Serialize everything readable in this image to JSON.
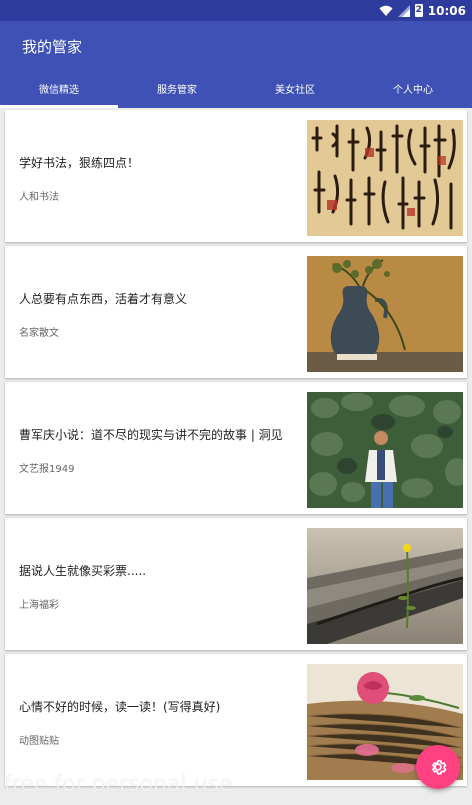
{
  "status_bar": {
    "time": "10:06",
    "icons": [
      "wifi-icon",
      "signal-icon",
      "battery-icon"
    ],
    "battery_text": "2"
  },
  "app_bar": {
    "title": "我的管家",
    "background_color": "#3f51b5"
  },
  "tabs": [
    {
      "label": "微信精选",
      "active": true
    },
    {
      "label": "服务管家",
      "active": false
    },
    {
      "label": "美女社区",
      "active": false
    },
    {
      "label": "个人中心",
      "active": false
    }
  ],
  "articles": [
    {
      "title": "学好书法，狠练四点！",
      "source": "人和书法",
      "image": "calligraphy-image"
    },
    {
      "title": "人总要有点东西，活着才有意义",
      "source": "名家散文",
      "image": "vase-with-branches-image"
    },
    {
      "title": "曹军庆小说：道不尽的现实与讲不完的故事 | 洞见",
      "source": "文艺报1949",
      "image": "man-by-stone-wall-image"
    },
    {
      "title": "据说人生就像买彩票.....",
      "source": "上海福彩",
      "image": "flower-in-crack-image"
    },
    {
      "title": "心情不好的时候，读一读！(写得真好)",
      "source": "动图贴贴",
      "image": "rose-on-book-image"
    }
  ],
  "fab": {
    "icon": "gear-icon",
    "color": "#ff4081"
  },
  "watermark": "free for personal use"
}
